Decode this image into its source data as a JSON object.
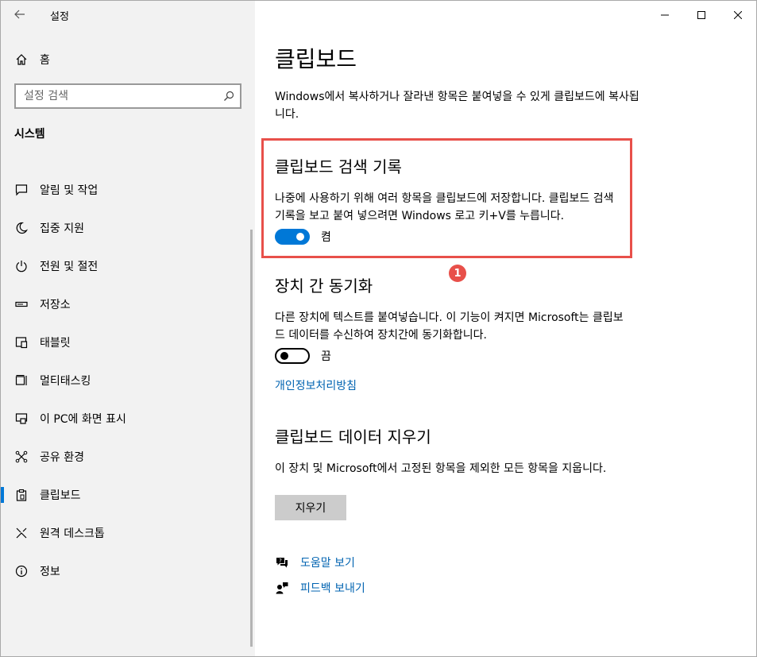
{
  "app": {
    "title": "설정",
    "back_icon": "back-arrow-icon"
  },
  "window_controls": {
    "minimize_icon": "minimize-icon",
    "maximize_icon": "maximize-icon",
    "close_icon": "close-icon"
  },
  "sidebar": {
    "home_label": "홈",
    "search_placeholder": "설정 검색",
    "section_title": "시스템",
    "items": [
      {
        "label": "알림 및 작업",
        "icon": "notification-icon"
      },
      {
        "label": "집중 지원",
        "icon": "moon-icon"
      },
      {
        "label": "전원 및 절전",
        "icon": "power-icon"
      },
      {
        "label": "저장소",
        "icon": "storage-icon"
      },
      {
        "label": "태블릿",
        "icon": "tablet-icon"
      },
      {
        "label": "멀티태스킹",
        "icon": "multitasking-icon"
      },
      {
        "label": "이 PC에 화면 표시",
        "icon": "project-icon"
      },
      {
        "label": "공유 환경",
        "icon": "share-icon"
      },
      {
        "label": "클립보드",
        "icon": "clipboard-icon",
        "selected": true
      },
      {
        "label": "원격 데스크톱",
        "icon": "remote-desktop-icon"
      },
      {
        "label": "정보",
        "icon": "info-icon"
      }
    ],
    "accent_color": "#0078d7"
  },
  "main": {
    "title": "클립보드",
    "intro": "Windows에서 복사하거나 잘라낸 항목은 붙여넣을 수 있게 클립보드에 복사됩니다.",
    "history": {
      "heading": "클립보드 검색 기록",
      "description": "나중에 사용하기 위해 여러 항목을 클립보드에 저장합니다. 클립보드 검색 기록을 보고 붙여 넣으려면 Windows 로고 키+V를 누릅니다.",
      "toggle_state": "on",
      "toggle_label": "켬"
    },
    "annotation": {
      "badge": "1",
      "color": "#e8504a"
    },
    "sync": {
      "heading": "장치 간 동기화",
      "description": "다른 장치에 텍스트를 붙여넣습니다. 이 기능이 켜지면 Microsoft는 클립보드 데이터를 수신하여 장치간에 동기화합니다.",
      "toggle_state": "off",
      "toggle_label": "끔",
      "privacy_link": "개인정보처리방침"
    },
    "clear": {
      "heading": "클립보드 데이터 지우기",
      "description": "이 장치 및 Microsoft에서 고정된 항목을 제외한 모든 항목을 지웁니다.",
      "button_label": "지우기"
    },
    "help": {
      "get_help": "도움말 보기",
      "feedback": "피드백 보내기"
    },
    "link_color": "#0063b1"
  }
}
